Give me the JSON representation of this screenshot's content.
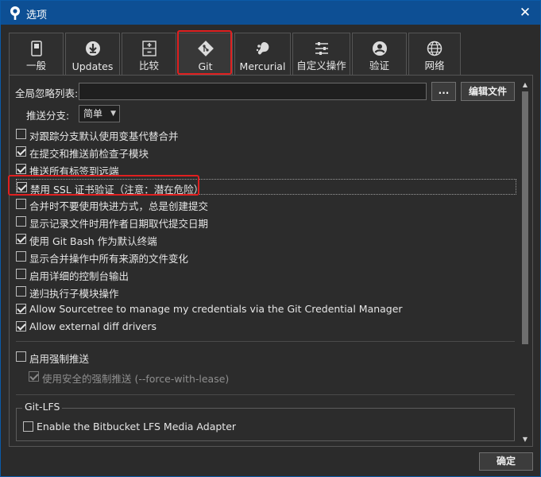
{
  "window": {
    "title": "选项"
  },
  "tabs": [
    {
      "label": "一般",
      "icon": "switch-icon"
    },
    {
      "label": "Updates",
      "icon": "download-icon"
    },
    {
      "label": "比较",
      "icon": "diff-icon"
    },
    {
      "label": "Git",
      "icon": "git-icon"
    },
    {
      "label": "Mercurial",
      "icon": "mercurial-icon"
    },
    {
      "label": "自定义操作",
      "icon": "custom-actions-icon"
    },
    {
      "label": "验证",
      "icon": "user-icon"
    },
    {
      "label": "网络",
      "icon": "globe-icon"
    }
  ],
  "active_tab": "Git",
  "git": {
    "ignore_label": "全局忽略列表:",
    "ignore_value": "",
    "browse_label": "...",
    "edit_file_label": "编辑文件",
    "push_branch_label": "推送分支:",
    "push_branch_value": "简单",
    "options": [
      {
        "label": "对跟踪分支默认使用变基代替合并",
        "checked": false
      },
      {
        "label": "在提交和推送前检查子模块",
        "checked": true
      },
      {
        "label": "推送所有标签到远端",
        "checked": true
      },
      {
        "label": "禁用 SSL 证书验证（注意：潜在危险）",
        "checked": true
      },
      {
        "label": "合并时不要使用快进方式，总是创建提交",
        "checked": false
      },
      {
        "label": "显示记录文件时用作者日期取代提交日期",
        "checked": false
      },
      {
        "label": "使用 Git Bash 作为默认终端",
        "checked": true
      },
      {
        "label": "显示合并操作中所有来源的文件变化",
        "checked": false
      },
      {
        "label": "启用详细的控制台输出",
        "checked": false
      },
      {
        "label": "递归执行子模块操作",
        "checked": false
      },
      {
        "label": "Allow Sourcetree to manage my credentials via the Git Credential Manager",
        "checked": true
      },
      {
        "label": "Allow external diff drivers",
        "checked": true
      }
    ],
    "force_push": {
      "label": "启用强制推送",
      "checked": false
    },
    "safe_force_push": {
      "label": "使用安全的强制推送 (--force-with-lease)",
      "checked": true,
      "disabled": true
    },
    "lfs_group_title": "Git-LFS",
    "lfs_option": {
      "label": "Enable the Bitbucket LFS Media Adapter",
      "checked": false
    }
  },
  "footer": {
    "ok_label": "确定"
  },
  "colors": {
    "accent": "#0d4f94",
    "highlight": "#e02020"
  }
}
